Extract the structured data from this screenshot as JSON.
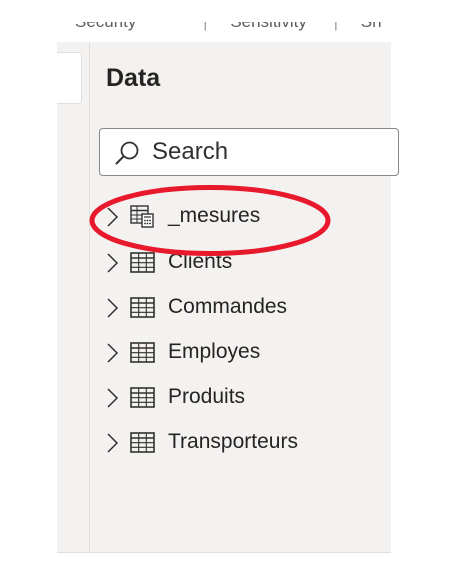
{
  "header": {
    "tabs": [
      {
        "label": "Security"
      },
      {
        "label": "Sensitivity"
      },
      {
        "label": "Sh"
      }
    ]
  },
  "data_pane": {
    "title": "Data",
    "search": {
      "placeholder": "Search",
      "icon": "search-icon"
    },
    "tables": [
      {
        "label": "_mesures",
        "icon": "measure-table-icon",
        "highlighted": true
      },
      {
        "label": "Clients",
        "icon": "table-icon"
      },
      {
        "label": "Commandes",
        "icon": "table-icon"
      },
      {
        "label": "Employes",
        "icon": "table-icon"
      },
      {
        "label": "Produits",
        "icon": "table-icon"
      },
      {
        "label": "Transporteurs",
        "icon": "table-icon"
      }
    ]
  },
  "colors": {
    "pane_background": "#f3f2f1",
    "text": "#252423",
    "highlight_circle": "#e8192c",
    "search_border": "#8a8886"
  }
}
